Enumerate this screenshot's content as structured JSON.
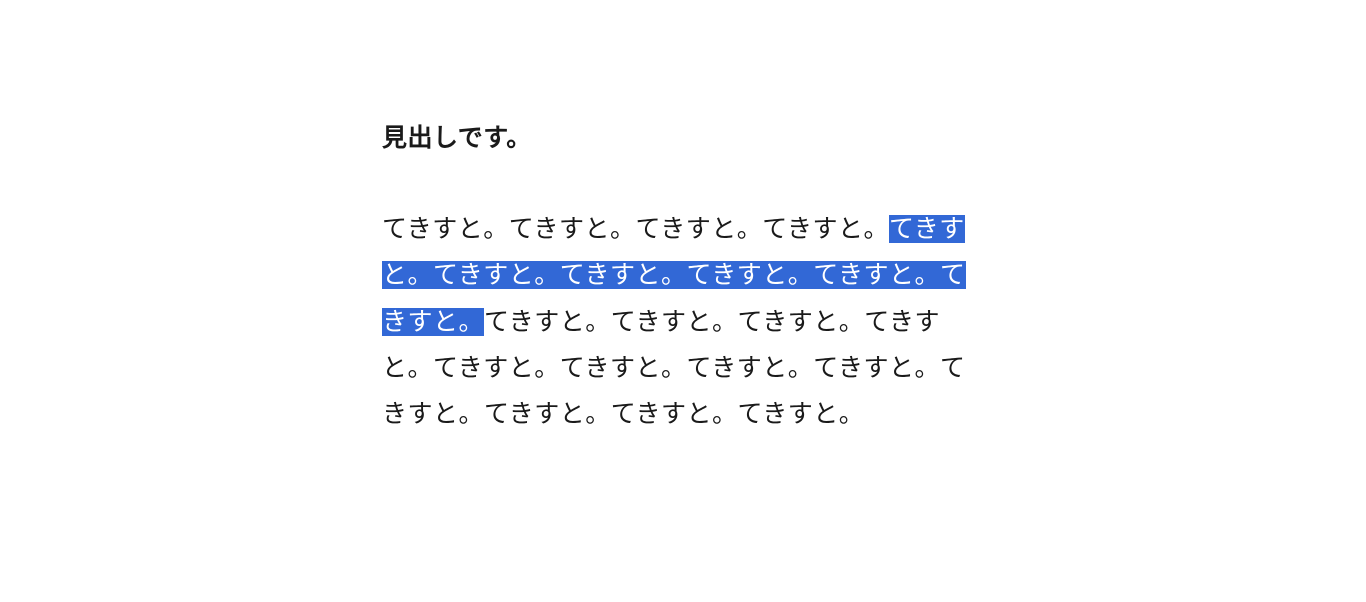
{
  "heading": "見出しです。",
  "paragraph": {
    "before": "てきすと。てきすと。てきすと。てきすと。",
    "selected": "てきすと。てきすと。てきすと。てきすと。てきすと。てきすと。",
    "after": "てきすと。てきすと。てきすと。てきすと。てきすと。てきすと。てきすと。てきすと。てきすと。てきすと。てきすと。てきすと。"
  },
  "selection_color": "#3268d6"
}
